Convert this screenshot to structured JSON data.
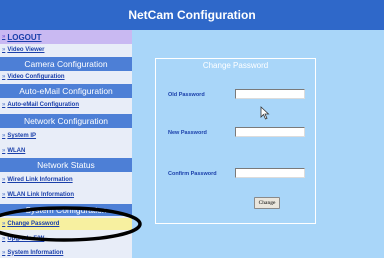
{
  "header": {
    "title": "NetCam Configuration"
  },
  "sidebar": {
    "logout": "LOGOUT",
    "video_viewer": "Video Viewer",
    "camera_header": "Camera Configuration",
    "video_configuration": "Video Configuration",
    "auto_email_header": "Auto-eMail Configuration",
    "auto_email_link": "Auto-eMail Configuration",
    "network_header": "Network Configuration",
    "system_ip": "System IP",
    "wlan": "WLAN",
    "network_status_header": "Network Status",
    "wired_link": "Wired Link Information",
    "wlan_link": "WLAN Link Information",
    "system_header": "System Configuration",
    "change_password": "Change Password",
    "upgrade_fw": "Upgrade F/W",
    "system_information": "System Information"
  },
  "main": {
    "panel_title": "Change Password",
    "old_password_label": "Old Password",
    "old_password_value": "",
    "new_password_label": "New Password",
    "new_password_value": "",
    "confirm_password_label": "Confirm Password",
    "confirm_password_value": "",
    "change_button": "Change"
  },
  "icons": {
    "nav_arrow": "double-chevron-right-icon",
    "cursor": "mouse-pointer-icon"
  },
  "colors": {
    "title_bar": "#2f68c9",
    "section_header": "#4d7fd6",
    "sidebar_bg": "#e8edf8",
    "content_bg": "#a9d6f9",
    "link": "#1a3faa",
    "logout_bg": "#c9b9f2",
    "highlight_bg": "#f7f0a0"
  }
}
